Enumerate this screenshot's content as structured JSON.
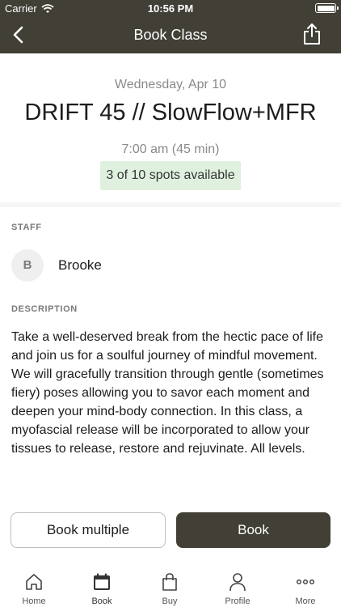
{
  "status_bar": {
    "carrier": "Carrier",
    "time": "10:56 PM"
  },
  "nav": {
    "title": "Book Class",
    "back_icon": "chevron-left-icon",
    "share_icon": "share-icon"
  },
  "class_info": {
    "date": "Wednesday, Apr 10",
    "name": "DRIFT 45 // SlowFlow+MFR",
    "time": "7:00 am (45 min)",
    "spots": "3 of 10 spots available"
  },
  "staff": {
    "label": "STAFF",
    "initial": "B",
    "name": "Brooke"
  },
  "description": {
    "label": "DESCRIPTION",
    "text": "Take a well-deserved break from the hectic pace of life and join us for a soulful journey of mindful movement. We will gracefully transition through gentle (sometimes fiery) poses allowing you to savor each moment and deepen your mind-body connection.  In this class, a myofascial release will be incorporated to allow your tissues to release, restore and rejuvinate. All levels."
  },
  "actions": {
    "book_multiple": "Book multiple",
    "book": "Book"
  },
  "tabs": [
    {
      "label": "Home",
      "icon": "home-icon"
    },
    {
      "label": "Book",
      "icon": "calendar-icon"
    },
    {
      "label": "Buy",
      "icon": "shopping-bag-icon"
    },
    {
      "label": "Profile",
      "icon": "profile-icon"
    },
    {
      "label": "More",
      "icon": "more-icon"
    }
  ],
  "colors": {
    "brand": "#413f36",
    "spots_bg": "#dff1de"
  }
}
